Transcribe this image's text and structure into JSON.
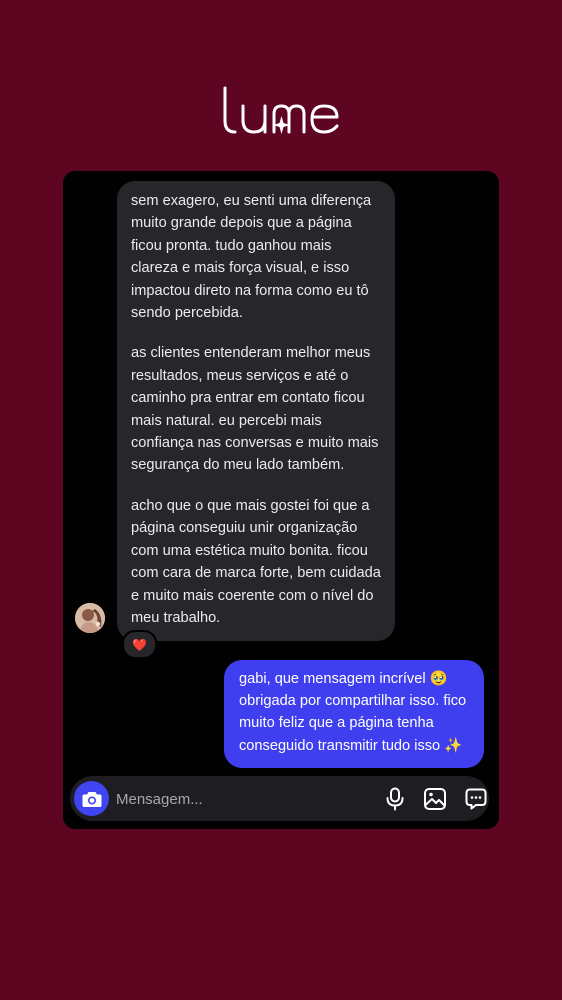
{
  "brand": {
    "name": "lume"
  },
  "colors": {
    "background": "#5e0522",
    "incoming_bubble": "#26262b",
    "outgoing_bubble": "#3f3ff0",
    "accent": "#3f46f1"
  },
  "conversation": {
    "incoming": {
      "paragraphs": [
        "sem exagero, eu senti uma diferença muito grande depois que a página ficou pronta. tudo ganhou mais clareza e mais força visual, e isso impactou direto na forma como eu tô sendo percebida.",
        "as clientes entenderam melhor meus resultados, meus serviços e até o caminho pra entrar em contato ficou mais natural. eu percebi mais confiança nas conversas e muito mais segurança do meu lado também.",
        "acho que o que mais gostei foi que a página conseguiu unir organização com uma estética muito bonita. ficou com cara de marca forte, bem cuidada e muito mais coerente com o nível do meu trabalho."
      ],
      "reaction": "❤️"
    },
    "outgoing": {
      "text": "gabi, que mensagem incrível 🥹 obrigada por compartilhar isso. fico muito feliz que a página tenha conseguido transmitir tudo isso ✨"
    }
  },
  "composer": {
    "placeholder": "Mensagem...",
    "icons": [
      "camera-icon",
      "microphone-icon",
      "image-icon",
      "sticker-icon",
      "plus-icon"
    ]
  }
}
